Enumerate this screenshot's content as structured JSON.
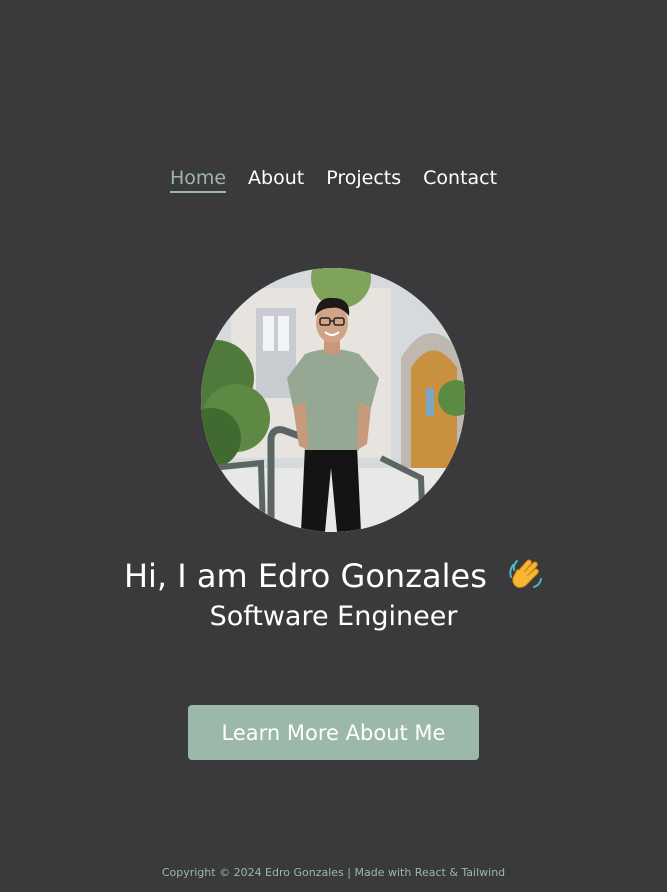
{
  "nav": {
    "items": [
      {
        "label": "Home",
        "active": true
      },
      {
        "label": "About",
        "active": false
      },
      {
        "label": "Projects",
        "active": false
      },
      {
        "label": "Contact",
        "active": false
      }
    ]
  },
  "hero": {
    "greeting": "Hi, I am Edro Gonzales",
    "emoji": "waving-hand-icon",
    "subtitle": "Software Engineer",
    "cta_label": "Learn More About Me"
  },
  "footer": {
    "text": "Copyright © 2024 Edro Gonzales | Made with React & Tailwind"
  },
  "colors": {
    "background": "#3a393b",
    "accent": "#9bb8ab",
    "text": "#ffffff"
  }
}
